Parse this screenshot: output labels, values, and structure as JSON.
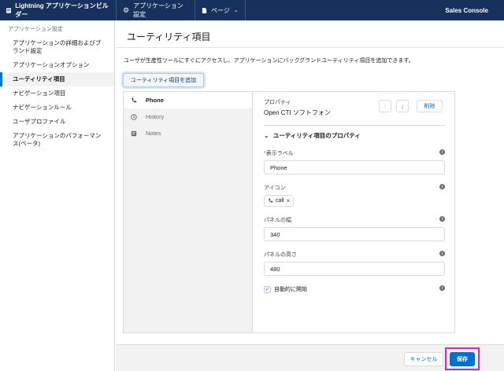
{
  "topbar": {
    "builder_title": "Lightning アプリケーションビルダー",
    "settings_label": "アプリケーション設定",
    "page_label": "ページ",
    "app_name": "Sales Console"
  },
  "sidebar": {
    "header": "アプリケーション設定",
    "items": [
      {
        "label": "アプリケーションの詳細およびブランド設定"
      },
      {
        "label": "アプリケーションオプション"
      },
      {
        "label": "ユーティリティ項目"
      },
      {
        "label": "ナビゲーション項目"
      },
      {
        "label": "ナビゲーションルール"
      },
      {
        "label": "ユーザプロファイル"
      },
      {
        "label": "アプリケーションのパフォーマンス(ベータ)"
      }
    ]
  },
  "main": {
    "title": "ユーティリティ項目",
    "description": "ユーザが生産性ツールにすぐにアクセスし、アプリケーションにバックグランドユーティリティ項目を追加できます。",
    "add_button": "ユーティリティ項目を追加"
  },
  "utility_items": [
    {
      "label": "Phone",
      "icon": "phone-icon"
    },
    {
      "label": "History",
      "icon": "clock-icon"
    },
    {
      "label": "Notes",
      "icon": "notes-icon"
    }
  ],
  "properties": {
    "label": "プロパティ",
    "name": "Open CTI ソフトフォン",
    "delete_label": "削除",
    "section_title": "ユーティリティ項目のプロパティ",
    "display_label_label": "表示ラベル",
    "display_label_value": "Phone",
    "icon_label": "アイコン",
    "icon_value": "call",
    "panel_width_label": "パネルの幅",
    "panel_width_value": "340",
    "panel_height_label": "パネルの高さ",
    "panel_height_value": "480",
    "autostart_label": "自動的に開始"
  },
  "footer": {
    "cancel_label": "キャンセル",
    "save_label": "保存"
  },
  "colors": {
    "topbar": "#16325c",
    "brand": "#0070d2",
    "highlight": "#e020c8"
  }
}
